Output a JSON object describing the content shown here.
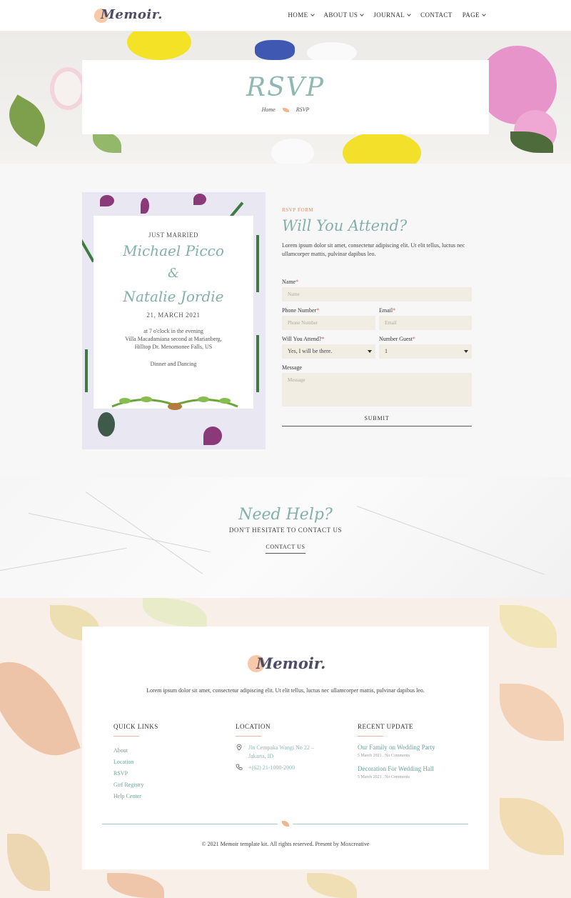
{
  "header": {
    "logo_text": "Memoir.",
    "nav": [
      {
        "label": "HOME",
        "dropdown": true
      },
      {
        "label": "ABOUT US",
        "dropdown": true
      },
      {
        "label": "JOURNAL",
        "dropdown": true
      },
      {
        "label": "CONTACT",
        "dropdown": false
      },
      {
        "label": "PAGE",
        "dropdown": true
      }
    ]
  },
  "hero": {
    "title": "RSVP",
    "breadcrumb": [
      "Home",
      "RSVP"
    ]
  },
  "invitation": {
    "label": "JUST MARRIED",
    "groom": "Michael Picco",
    "amp": "&",
    "bride": "Natalie Jordie",
    "date": "21, MARCH 2021",
    "lines": [
      "at 7 o'clock in the evening",
      "Villa Macadamiana second at Marianberg,",
      "Hilltop Dr. Menomonee Falls, US"
    ],
    "extra": "Dinner and Dancing"
  },
  "form": {
    "eyebrow": "RSVP FORM",
    "title": "Will You Attend?",
    "description": "Lorem ipsum dolor sit amet, consectetur adipiscing elit. Ut elit tellus, luctus nec ullamcorper mattis, pulvinar dapibus leo.",
    "name_label": "Name",
    "name_placeholder": "Name",
    "phone_label": "Phone Number",
    "phone_placeholder": "Phone Number",
    "email_label": "Email",
    "email_placeholder": "Email",
    "attend_label": "Will You Attend?",
    "attend_value": "Yes, I will be there.",
    "guest_label": "Number Guest",
    "guest_value": "1",
    "message_label": "Message",
    "message_placeholder": "Message",
    "required_mark": "*",
    "submit_label": "SUBMIT"
  },
  "help": {
    "title": "Need Help?",
    "subtitle": "DON'T HESITATE TO CONTACT US",
    "button": "CONTACT US"
  },
  "footer": {
    "logo_text": "Memoir.",
    "description": "Lorem ipsum dolor sit amet, consectetur adipiscing elit. Ut elit tellus, luctus nec ullamcorper mattis, pulvinar dapibus leo.",
    "quick_links_title": "QUICK LINKS",
    "quick_links": [
      "About",
      "Location",
      "RSVP",
      "Girf Registry",
      "Help Center"
    ],
    "location_title": "LOCATION",
    "address_line1": "Jln Cempaka Wangi No 22 –",
    "address_line2": "Jakarta, ID",
    "phone": "+(62) 21-1000-2000",
    "recent_title": "RECENT UPDATE",
    "posts": [
      {
        "title": "Our Family on Wedding Party",
        "meta": "5 March 2021 . No Comments"
      },
      {
        "title": "Decoration For Wedding Hall",
        "meta": "5 March 2021 . No Comments"
      }
    ],
    "copyright": "© 2021 Memoir template kit. All rights reserved. Present by Moxcreative"
  }
}
